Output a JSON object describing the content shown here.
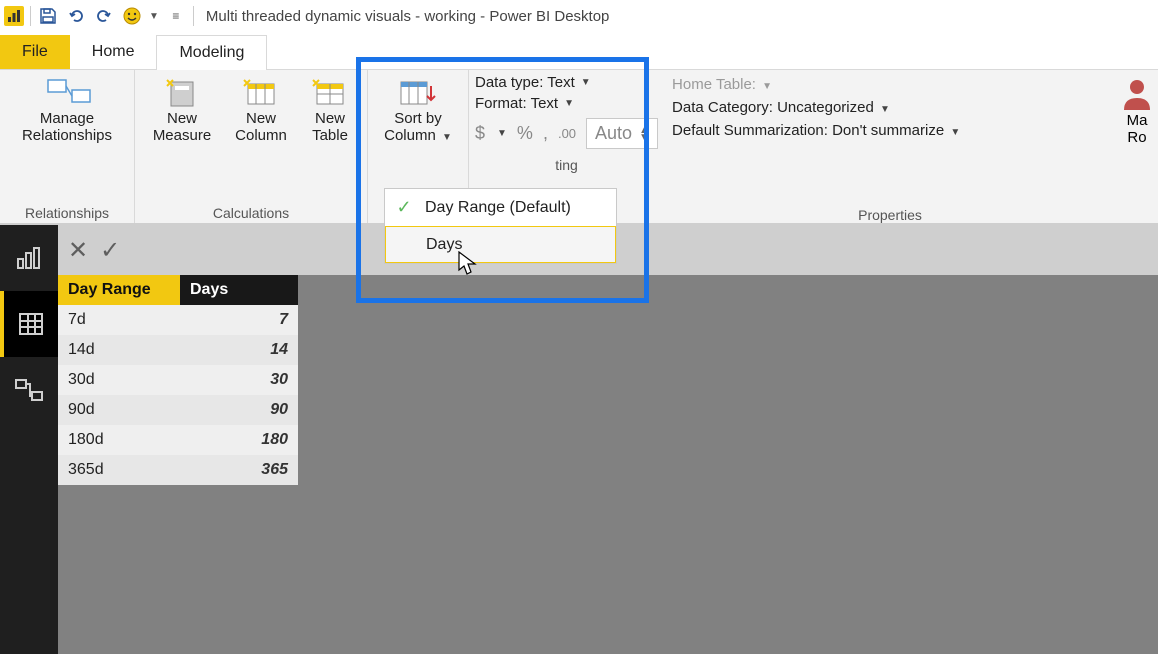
{
  "title": "Multi threaded dynamic visuals - working - Power BI Desktop",
  "tabs": {
    "file": "File",
    "home": "Home",
    "modeling": "Modeling"
  },
  "ribbon": {
    "manage_rel": "Manage\nRelationships",
    "new_measure": "New\nMeasure",
    "new_column": "New\nColumn",
    "new_table": "New\nTable",
    "sort_by": "Sort by\nColumn",
    "group_rel": "Relationships",
    "group_calc": "Calculations",
    "group_props": "Properties",
    "data_type": "Data type: Text",
    "format": "Format: Text",
    "auto": "Auto",
    "home_table": "Home Table:",
    "data_cat": "Data Category: Uncategorized",
    "default_summ": "Default Summarization: Don't summarize",
    "manage_roles": "Ma\nRo"
  },
  "sort_menu": {
    "default": "Day Range (Default)",
    "days": "Days"
  },
  "formatting_visible": "ting",
  "table": {
    "headers": [
      "Day Range",
      "Days"
    ],
    "rows": [
      [
        "7d",
        "7"
      ],
      [
        "14d",
        "14"
      ],
      [
        "30d",
        "30"
      ],
      [
        "90d",
        "90"
      ],
      [
        "180d",
        "180"
      ],
      [
        "365d",
        "365"
      ]
    ]
  }
}
